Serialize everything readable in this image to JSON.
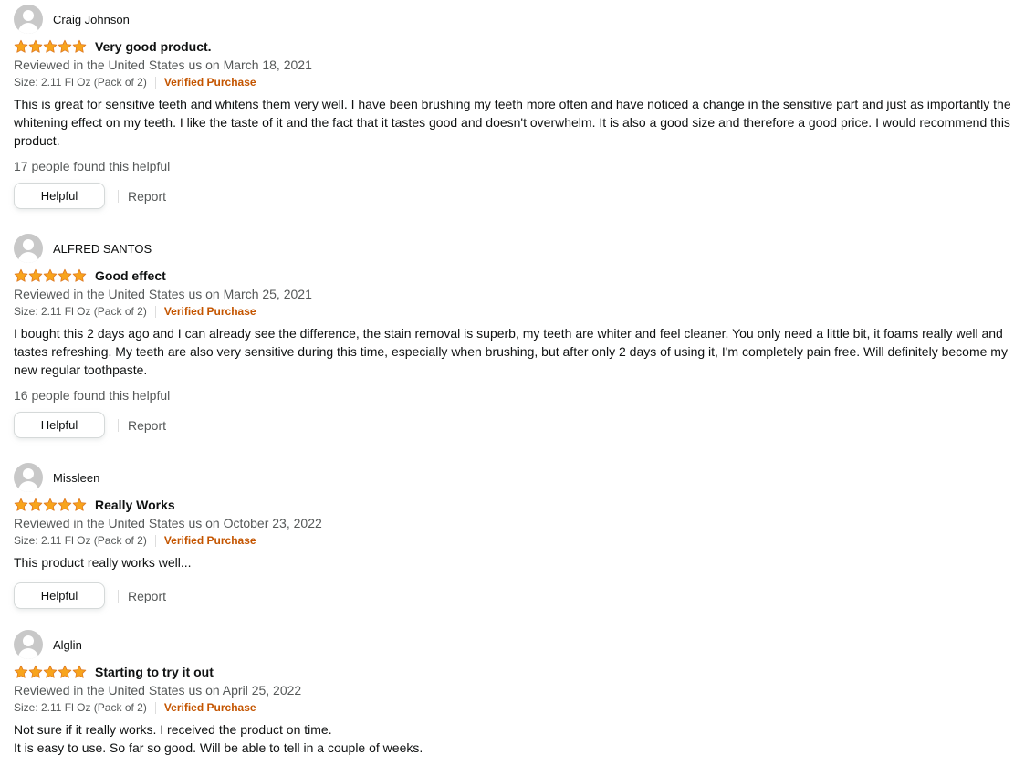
{
  "colors": {
    "star_fill": "#f8a41c",
    "star_stroke": "#de7921",
    "verified": "#c45500",
    "secondary_text": "#565959"
  },
  "icons": {
    "avatar": "default-user-avatar-icon",
    "star": "filled-star-icon"
  },
  "reviews": [
    {
      "reviewer": "Craig Johnson",
      "rating": 5,
      "title": "Very good product.",
      "date": "Reviewed in the United States us on March 18, 2021",
      "size": "Size: 2.11 Fl Oz (Pack of 2)",
      "verified": "Verified Purchase",
      "body": [
        "This is great for sensitive teeth and whitens them very well. I have been brushing my teeth more often and have noticed a change in the sensitive part and just as importantly the whitening effect on my teeth. I like the taste of it and the fact that it tastes good and doesn't overwhelm. It is also a good size and therefore a good price. I would recommend this product."
      ],
      "helpful_count": "17 people found this helpful",
      "helpful_label": "Helpful",
      "report_label": "Report"
    },
    {
      "reviewer": "ALFRED SANTOS",
      "rating": 5,
      "title": "Good effect",
      "date": "Reviewed in the United States us on March 25, 2021",
      "size": "Size: 2.11 Fl Oz (Pack of 2)",
      "verified": "Verified Purchase",
      "body": [
        "I bought this 2 days ago and I can already see the difference, the stain removal is superb, my teeth are whiter and feel cleaner. You only need a little bit, it foams really well and tastes refreshing. My teeth are also very sensitive during this time, especially when brushing, but after only 2 days of using it, I'm completely pain free. Will definitely become my new regular toothpaste."
      ],
      "helpful_count": "16 people found this helpful",
      "helpful_label": "Helpful",
      "report_label": "Report"
    },
    {
      "reviewer": "Missleen",
      "rating": 5,
      "title": "Really Works",
      "date": "Reviewed in the United States us on October 23, 2022",
      "size": "Size: 2.11 Fl Oz (Pack of 2)",
      "verified": "Verified Purchase",
      "body": [
        "This product really works well..."
      ],
      "helpful_label": "Helpful",
      "report_label": "Report"
    },
    {
      "reviewer": "Alglin",
      "rating": 5,
      "title": "Starting to try it out",
      "date": "Reviewed in the United States us on April 25, 2022",
      "size": "Size: 2.11 Fl Oz (Pack of 2)",
      "verified": "Verified Purchase",
      "body": [
        "Not sure if it really works. I received the product on time.",
        "It is easy to use. So far so good. Will be able to tell in a couple of weeks."
      ]
    }
  ]
}
